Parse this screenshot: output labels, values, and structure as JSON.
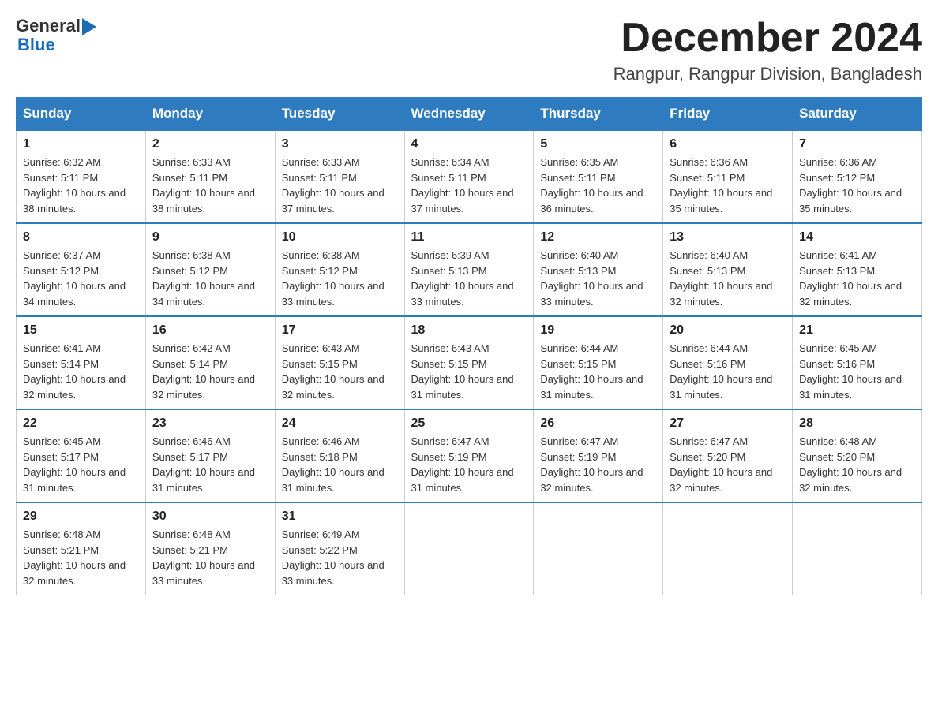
{
  "header": {
    "logo_general": "General",
    "logo_blue": "Blue",
    "month_title": "December 2024",
    "location": "Rangpur, Rangpur Division, Bangladesh"
  },
  "days_of_week": [
    "Sunday",
    "Monday",
    "Tuesday",
    "Wednesday",
    "Thursday",
    "Friday",
    "Saturday"
  ],
  "weeks": [
    [
      {
        "day": "1",
        "sunrise": "6:32 AM",
        "sunset": "5:11 PM",
        "daylight": "10 hours and 38 minutes."
      },
      {
        "day": "2",
        "sunrise": "6:33 AM",
        "sunset": "5:11 PM",
        "daylight": "10 hours and 38 minutes."
      },
      {
        "day": "3",
        "sunrise": "6:33 AM",
        "sunset": "5:11 PM",
        "daylight": "10 hours and 37 minutes."
      },
      {
        "day": "4",
        "sunrise": "6:34 AM",
        "sunset": "5:11 PM",
        "daylight": "10 hours and 37 minutes."
      },
      {
        "day": "5",
        "sunrise": "6:35 AM",
        "sunset": "5:11 PM",
        "daylight": "10 hours and 36 minutes."
      },
      {
        "day": "6",
        "sunrise": "6:36 AM",
        "sunset": "5:11 PM",
        "daylight": "10 hours and 35 minutes."
      },
      {
        "day": "7",
        "sunrise": "6:36 AM",
        "sunset": "5:12 PM",
        "daylight": "10 hours and 35 minutes."
      }
    ],
    [
      {
        "day": "8",
        "sunrise": "6:37 AM",
        "sunset": "5:12 PM",
        "daylight": "10 hours and 34 minutes."
      },
      {
        "day": "9",
        "sunrise": "6:38 AM",
        "sunset": "5:12 PM",
        "daylight": "10 hours and 34 minutes."
      },
      {
        "day": "10",
        "sunrise": "6:38 AM",
        "sunset": "5:12 PM",
        "daylight": "10 hours and 33 minutes."
      },
      {
        "day": "11",
        "sunrise": "6:39 AM",
        "sunset": "5:13 PM",
        "daylight": "10 hours and 33 minutes."
      },
      {
        "day": "12",
        "sunrise": "6:40 AM",
        "sunset": "5:13 PM",
        "daylight": "10 hours and 33 minutes."
      },
      {
        "day": "13",
        "sunrise": "6:40 AM",
        "sunset": "5:13 PM",
        "daylight": "10 hours and 32 minutes."
      },
      {
        "day": "14",
        "sunrise": "6:41 AM",
        "sunset": "5:13 PM",
        "daylight": "10 hours and 32 minutes."
      }
    ],
    [
      {
        "day": "15",
        "sunrise": "6:41 AM",
        "sunset": "5:14 PM",
        "daylight": "10 hours and 32 minutes."
      },
      {
        "day": "16",
        "sunrise": "6:42 AM",
        "sunset": "5:14 PM",
        "daylight": "10 hours and 32 minutes."
      },
      {
        "day": "17",
        "sunrise": "6:43 AM",
        "sunset": "5:15 PM",
        "daylight": "10 hours and 32 minutes."
      },
      {
        "day": "18",
        "sunrise": "6:43 AM",
        "sunset": "5:15 PM",
        "daylight": "10 hours and 31 minutes."
      },
      {
        "day": "19",
        "sunrise": "6:44 AM",
        "sunset": "5:15 PM",
        "daylight": "10 hours and 31 minutes."
      },
      {
        "day": "20",
        "sunrise": "6:44 AM",
        "sunset": "5:16 PM",
        "daylight": "10 hours and 31 minutes."
      },
      {
        "day": "21",
        "sunrise": "6:45 AM",
        "sunset": "5:16 PM",
        "daylight": "10 hours and 31 minutes."
      }
    ],
    [
      {
        "day": "22",
        "sunrise": "6:45 AM",
        "sunset": "5:17 PM",
        "daylight": "10 hours and 31 minutes."
      },
      {
        "day": "23",
        "sunrise": "6:46 AM",
        "sunset": "5:17 PM",
        "daylight": "10 hours and 31 minutes."
      },
      {
        "day": "24",
        "sunrise": "6:46 AM",
        "sunset": "5:18 PM",
        "daylight": "10 hours and 31 minutes."
      },
      {
        "day": "25",
        "sunrise": "6:47 AM",
        "sunset": "5:19 PM",
        "daylight": "10 hours and 31 minutes."
      },
      {
        "day": "26",
        "sunrise": "6:47 AM",
        "sunset": "5:19 PM",
        "daylight": "10 hours and 32 minutes."
      },
      {
        "day": "27",
        "sunrise": "6:47 AM",
        "sunset": "5:20 PM",
        "daylight": "10 hours and 32 minutes."
      },
      {
        "day": "28",
        "sunrise": "6:48 AM",
        "sunset": "5:20 PM",
        "daylight": "10 hours and 32 minutes."
      }
    ],
    [
      {
        "day": "29",
        "sunrise": "6:48 AM",
        "sunset": "5:21 PM",
        "daylight": "10 hours and 32 minutes."
      },
      {
        "day": "30",
        "sunrise": "6:48 AM",
        "sunset": "5:21 PM",
        "daylight": "10 hours and 33 minutes."
      },
      {
        "day": "31",
        "sunrise": "6:49 AM",
        "sunset": "5:22 PM",
        "daylight": "10 hours and 33 minutes."
      },
      null,
      null,
      null,
      null
    ]
  ]
}
